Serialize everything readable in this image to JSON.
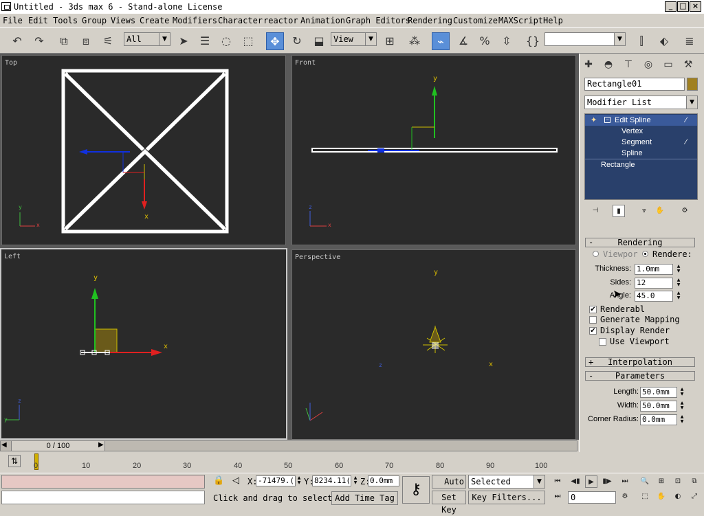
{
  "window": {
    "title": "Untitled - 3ds max 6 - Stand-alone License",
    "minimize": "_",
    "maximize": "□",
    "close": "×"
  },
  "menu": [
    "File",
    "Edit",
    "Tools",
    "Group",
    "Views",
    "Create",
    "Modifiers",
    "Character",
    "reactor",
    "Animation",
    "Graph Editors",
    "Rendering",
    "Customize",
    "MAXScript",
    "Help"
  ],
  "toolbar": {
    "selection_filter": "All",
    "reference_coord": "View",
    "named_selection": ""
  },
  "viewports": {
    "top": {
      "label": "Top"
    },
    "front": {
      "label": "Front"
    },
    "left": {
      "label": "Left"
    },
    "perspective": {
      "label": "Perspective"
    }
  },
  "axis": {
    "x": "x",
    "y": "y",
    "z": "z"
  },
  "command_panel": {
    "object_name": "Rectangle01",
    "object_color": "#a08020",
    "modifier_list": "Modifier List",
    "stack": {
      "edit_spline": "Edit Spline",
      "vertex": "Vertex",
      "segment": "Segment",
      "spline": "Spline",
      "rectangle": "Rectangle"
    },
    "rendering": {
      "header": "Rendering",
      "sign": "-",
      "viewport": "Viewpor",
      "renderer": "Rendere:",
      "thickness_label": "Thickness:",
      "thickness": "1.0mm",
      "sides_label": "Sides:",
      "sides": "12",
      "angle_label": "Angle:",
      "angle": "45.0",
      "renderable": "Renderabl",
      "generate_mapping": "Generate Mapping",
      "display_render": "Display Render",
      "use_viewport": "Use Viewport",
      "check": "✔"
    },
    "interpolation": {
      "header": "Interpolation",
      "sign": "+"
    },
    "parameters": {
      "header": "Parameters",
      "sign": "-",
      "length_label": "Length:",
      "length": "50.0mm",
      "width_label": "Width:",
      "width": "50.0mm",
      "corner_radius_label": "Corner Radius:",
      "corner_radius": "0.0mm"
    }
  },
  "timeline": {
    "slider_label": "0 / 100",
    "ticks": [
      "0",
      "10",
      "20",
      "30",
      "40",
      "50",
      "60",
      "70",
      "80",
      "90",
      "100"
    ]
  },
  "status": {
    "x_label": "X:",
    "x_value": "-71479.(",
    "y_label": "Y:",
    "y_value": "8234.11(",
    "z_label": "Z:",
    "z_value": "0.0mm",
    "prompt": "Click and drag to select",
    "add_time_tag": "Add Time Tag",
    "auto_key": "Auto Key",
    "set_key": "Set Key",
    "key_mode": "Selected",
    "key_filters": "Key Filters...",
    "current_frame": "0"
  }
}
